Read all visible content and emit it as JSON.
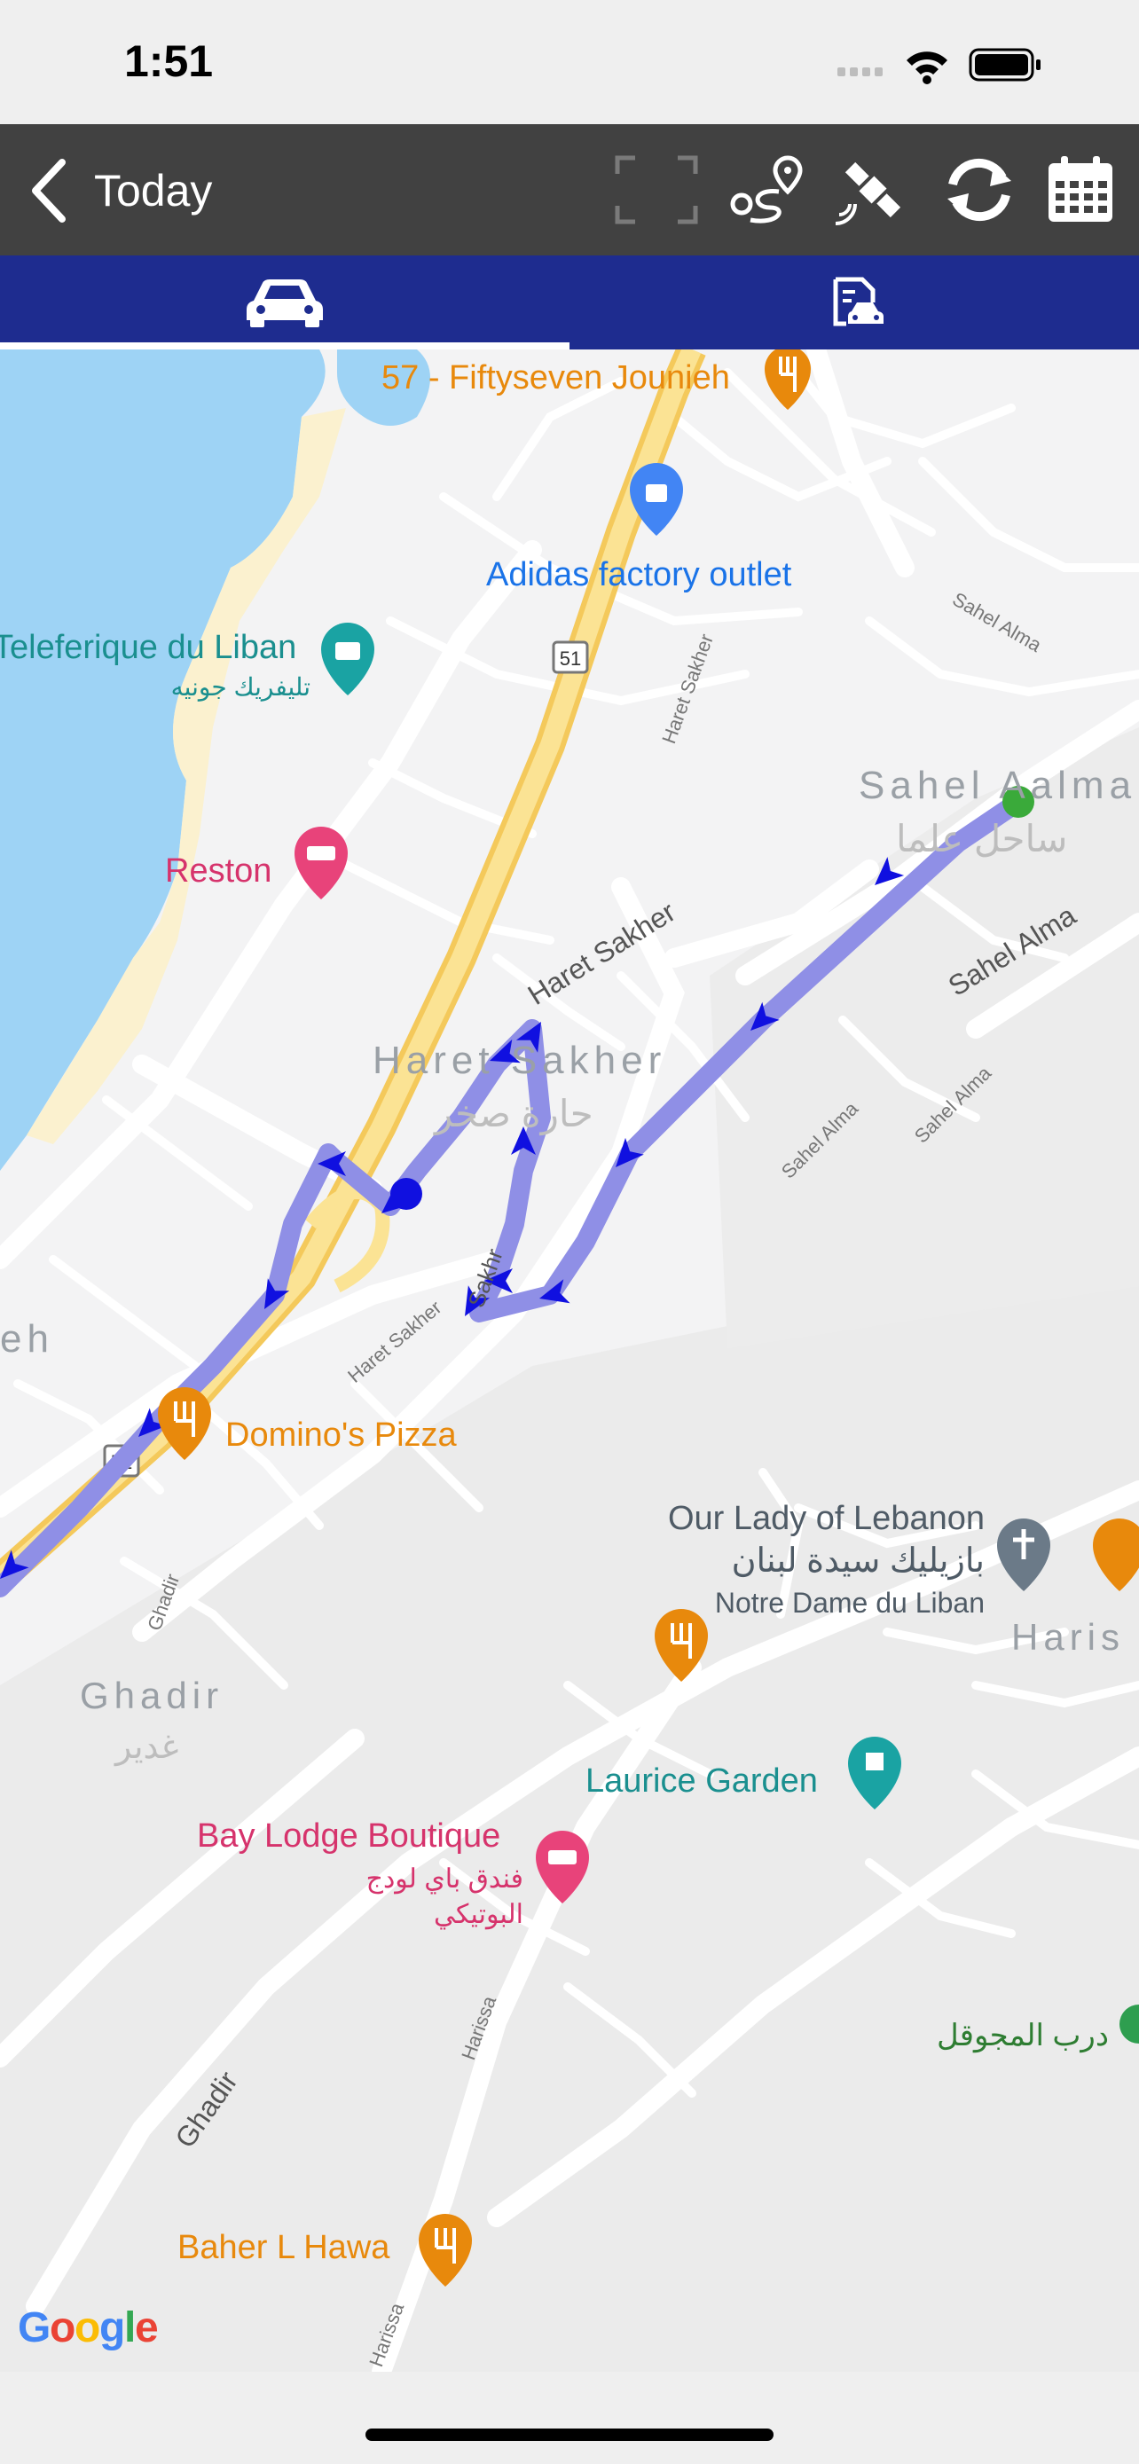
{
  "status_bar": {
    "time": "1:51"
  },
  "navbar": {
    "back_label": "Today"
  },
  "tabs": [
    {
      "icon": "car-icon",
      "active": true
    },
    {
      "icon": "vehicle-document-icon",
      "active": false
    }
  ],
  "map": {
    "labels": {
      "fiftyseven": "57 - Fiftyseven Jounieh",
      "adidas": "Adidas factory outlet",
      "teleferique": "Teleferique du Liban",
      "teleferique_ar": "تليفريك جونيه",
      "reston": "Reston",
      "haret_sakher_road": "Haret Sakher",
      "haret_sakher_area": "Haret Sakher",
      "haret_sakher_ar": "حارة صخر",
      "haret_sakher_road2": "Haret Sakher",
      "haret_sakher_road3": "Haret Sakher",
      "sahel_alma_area": "Sahel Aalma",
      "sahel_alma_ar": "ساحل علما",
      "sahel_alma_road": "Sahel Alma",
      "sahel_alma_small1": "Sahel Alma",
      "sahel_alma_small2": "Sahel Alma",
      "sahel_alma_small3": "Sahel Alma",
      "ghadir_fragment": "eh",
      "route_51_a": "51",
      "route_51_b": "51",
      "dominos": "Domino's Pizza",
      "our_lady": "Our Lady of Lebanon",
      "our_lady_ar": "بازيليك سيدة لبنان",
      "notre_dame": "Notre Dame du Liban",
      "harissa_fragment": "Haris",
      "ghadir": "Ghadir",
      "ghadir_ar": "غدير",
      "ghadir_small": "Ghadir",
      "laurice": "Laurice Garden",
      "bay_lodge": "Bay Lodge Boutique",
      "bay_lodge_ar1": "فندق باي لودج",
      "bay_lodge_ar2": "البوتيكي",
      "darb": "درب المجوقل",
      "ghadir_road": "Ghadir",
      "harissa_road": "Harissa",
      "harissa_road2": "Harissa",
      "baher": "Baher L Hawa",
      "sakher_fragment": "Sakhr"
    },
    "google_logo": "Google",
    "colors": {
      "route": "#8f8fe6",
      "arrow": "#1010e0",
      "start": "#3aaa3a",
      "current": "#1010e0",
      "sea": "#9ed3f5",
      "highway": "#f7d86b",
      "food": "#e8890c",
      "shop": "#4285f4",
      "attraction": "#1aa3a3",
      "hotel": "#e8437a",
      "church": "#6b7a88"
    }
  }
}
